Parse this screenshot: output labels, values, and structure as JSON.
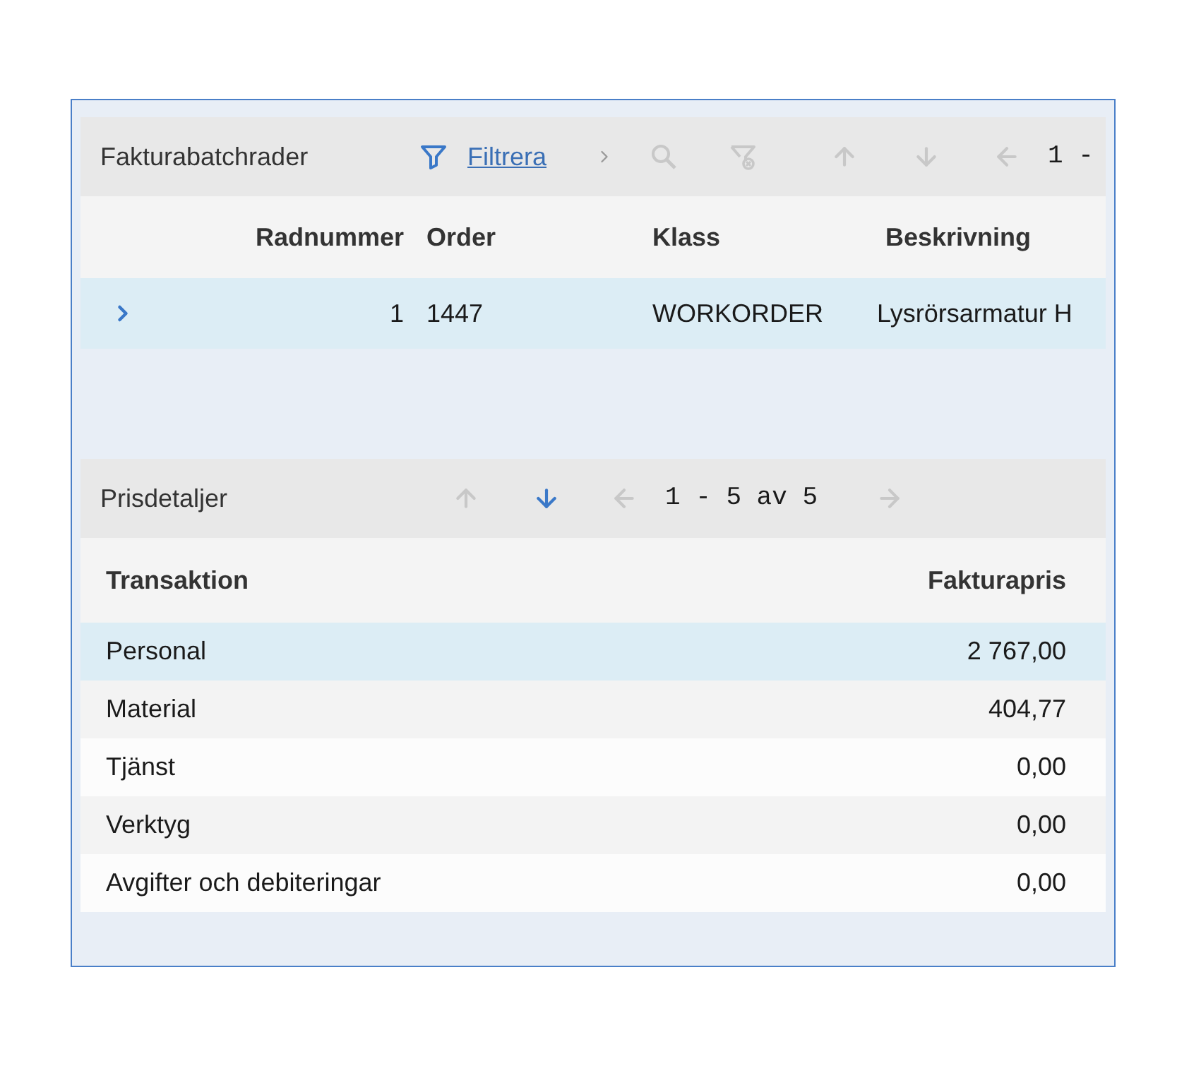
{
  "batch_lines": {
    "title": "Fakturabatchrader",
    "filter_link": "Filtrera",
    "tools": [
      {
        "kind": "search",
        "disabled": true
      },
      {
        "kind": "clear_filter",
        "disabled": true
      },
      {
        "kind": "up",
        "disabled": true
      },
      {
        "kind": "down",
        "disabled": true
      },
      {
        "kind": "previous",
        "disabled": true
      }
    ],
    "pagination": "1 -",
    "columns": [
      "Radnummer",
      "Order",
      "Klass",
      "Beskrivning"
    ],
    "rows": [
      {
        "selected": true,
        "expanded": false,
        "cells": [
          "1",
          "1447",
          "WORKORDER",
          "Lysrörsarmatur H"
        ]
      }
    ]
  },
  "price_details": {
    "title": "Prisdetaljer",
    "tools": [
      {
        "kind": "up",
        "disabled": true
      },
      {
        "kind": "down",
        "disabled": false
      },
      {
        "kind": "previous",
        "disabled": true
      }
    ],
    "pagination": "1 - 5 av 5",
    "next": {
      "disabled": true
    },
    "columns": [
      "Transaktion",
      "Fakturapris"
    ],
    "rows": [
      {
        "transaction": "Personal",
        "invoice_price": "2 767,00",
        "selected": true
      },
      {
        "transaction": "Material",
        "invoice_price": "404,77",
        "selected": false
      },
      {
        "transaction": "Tjänst",
        "invoice_price": "0,00",
        "selected": false
      },
      {
        "transaction": "Verktyg",
        "invoice_price": "0,00",
        "selected": false
      },
      {
        "transaction": "Avgifter och debiteringar",
        "invoice_price": "0,00",
        "selected": false
      }
    ]
  }
}
